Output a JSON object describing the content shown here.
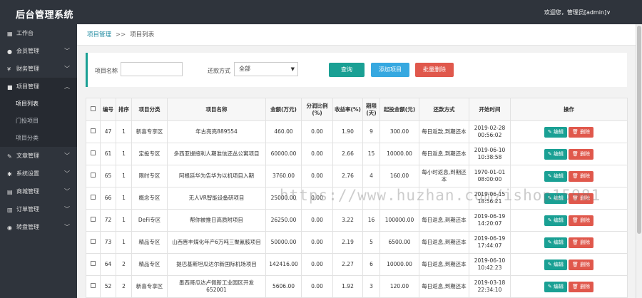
{
  "header": {
    "title": "后台管理系统",
    "user_greeting": "欢迎您，管理员[admin]∨"
  },
  "sidebar": {
    "items": [
      {
        "label": "工作台",
        "icon": "dashboard-icon",
        "has_chevron": false
      },
      {
        "label": "会员管理",
        "icon": "user-icon",
        "has_chevron": true
      },
      {
        "label": "财务管理",
        "icon": "money-icon",
        "has_chevron": true
      },
      {
        "label": "项目管理",
        "icon": "project-icon",
        "has_chevron": true,
        "expanded": true,
        "children": [
          "项目列表",
          "门投项目",
          "项目分类"
        ]
      },
      {
        "label": "文章管理",
        "icon": "article-icon",
        "has_chevron": true
      },
      {
        "label": "系统设置",
        "icon": "gear-icon",
        "has_chevron": true
      },
      {
        "label": "商城管理",
        "icon": "shop-icon",
        "has_chevron": true
      },
      {
        "label": "订单管理",
        "icon": "order-icon",
        "has_chevron": true
      },
      {
        "label": "转盘管理",
        "icon": "wheel-icon",
        "has_chevron": true
      }
    ]
  },
  "breadcrumb": {
    "parent": "项目管理",
    "separator": ">>",
    "current": "项目列表"
  },
  "filter": {
    "name_label": "项目名称",
    "name_value": "",
    "repay_label": "还款方式",
    "repay_selected": "全部",
    "search_btn": "查询",
    "add_btn": "添加项目",
    "batch_delete_btn": "批量删除"
  },
  "table": {
    "headers": [
      "",
      "编号",
      "排序",
      "项目分类",
      "项目名称",
      "金额(万元)",
      "分润比例(%)",
      "收益率(%)",
      "期限(天)",
      "起投金额(元)",
      "还款方式",
      "开始时间",
      "操作"
    ],
    "edit_label": "编辑",
    "delete_label": "删除",
    "rows": [
      {
        "id": "47",
        "sort": "1",
        "category": "新喜专享区",
        "name": "年古亮亮889554",
        "amount": "460.00",
        "share": "0.00",
        "rate": "1.90",
        "term": "9",
        "min": "300.00",
        "repay": "每日返款,到期还本",
        "start": "2019-02-28 00:56:02"
      },
      {
        "id": "61",
        "sort": "1",
        "category": "定投专区",
        "name": "多西亚提接利人期准信还丛公寓项目",
        "amount": "60000.00",
        "share": "0.00",
        "rate": "2.66",
        "term": "15",
        "min": "10000.00",
        "repay": "每日返息,到期还本",
        "start": "2019-06-10 10:38:58"
      },
      {
        "id": "65",
        "sort": "1",
        "category": "限时专区",
        "name": "阿根廷华为告华为以机项目入期",
        "amount": "3760.00",
        "share": "0.00",
        "rate": "2.76",
        "term": "4",
        "min": "160.00",
        "repay": "每小时返息,到期还本",
        "start": "1970-01-01 08:00:00"
      },
      {
        "id": "66",
        "sort": "1",
        "category": "概念专区",
        "name": "无人VR智能设备研项目",
        "amount": "25000.00",
        "share": "0.00",
        "rate": "",
        "term": "",
        "min": "",
        "repay": "",
        "start": "2019-06-15 18:56:21"
      },
      {
        "id": "72",
        "sort": "1",
        "category": "DeFi专区",
        "name": "帮你被推日高质附项目",
        "amount": "26250.00",
        "share": "0.00",
        "rate": "3.22",
        "term": "16",
        "min": "100000.00",
        "repay": "每日返息,到期还本",
        "start": "2019-06-19 14:20:07"
      },
      {
        "id": "73",
        "sort": "1",
        "category": "精品专区",
        "name": "山西晋丰煤化年产6万吨三聚氰胺项目",
        "amount": "50000.00",
        "share": "0.00",
        "rate": "2.19",
        "term": "5",
        "min": "6500.00",
        "repay": "每日返息,到期还本",
        "start": "2019-06-19 17:44:07"
      },
      {
        "id": "64",
        "sort": "2",
        "category": "精品专区",
        "name": "提巴基斯坦瓜达尔新国际机场项目",
        "amount": "142416.00",
        "share": "0.00",
        "rate": "2.27",
        "term": "6",
        "min": "10000.00",
        "repay": "每日返息,到期还本",
        "start": "2019-06-10 10:42:23"
      },
      {
        "id": "52",
        "sort": "2",
        "category": "新喜专享区",
        "name": "墨西哥瓜达卢佩新工业园区开发652001",
        "amount": "5606.00",
        "share": "0.00",
        "rate": "1.92",
        "term": "3",
        "min": "120.00",
        "repay": "每日返息,到期还本",
        "start": "2019-03-18 22:34:10"
      }
    ]
  },
  "watermark": "https://www.huzhan.com/ishop15981"
}
